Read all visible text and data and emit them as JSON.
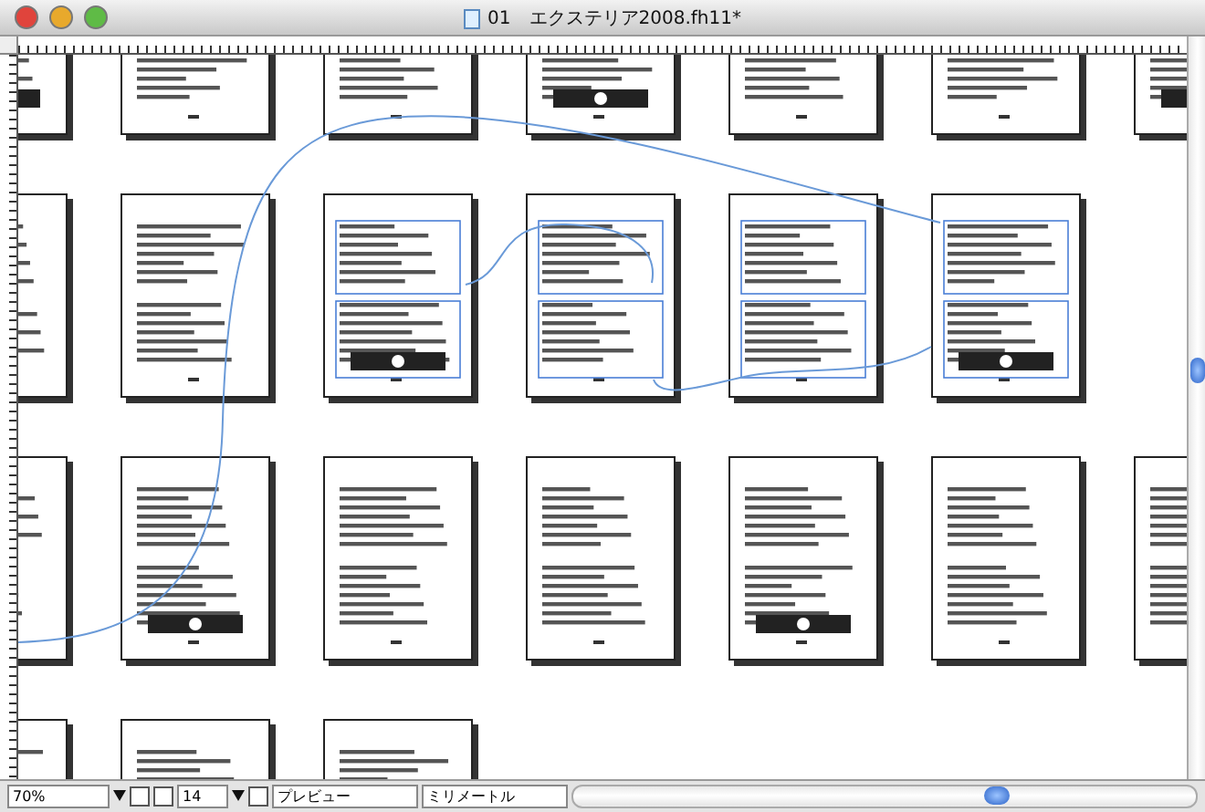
{
  "window": {
    "title": "01　エクステリア2008.fh11*"
  },
  "pasteboard": {
    "page_rows": [
      {
        "pages": [
          {
            "selected": false
          },
          {
            "selected": false
          },
          {
            "selected": false
          },
          {
            "selected": false
          },
          {
            "selected": false
          },
          {
            "selected": false
          },
          {
            "selected": false
          }
        ]
      },
      {
        "pages": [
          {
            "selected": false
          },
          {
            "selected": false
          },
          {
            "selected": true
          },
          {
            "selected": true
          },
          {
            "selected": true
          },
          {
            "selected": true
          }
        ]
      },
      {
        "pages": [
          {
            "selected": false
          },
          {
            "selected": false
          },
          {
            "selected": false
          },
          {
            "selected": false
          },
          {
            "selected": false
          },
          {
            "selected": false
          },
          {
            "selected": false
          }
        ]
      },
      {
        "pages": [
          {
            "selected": false
          },
          {
            "selected": false
          },
          {
            "selected": false
          }
        ]
      }
    ]
  },
  "status_bar": {
    "zoom": "70%",
    "page": "14",
    "display_mode": "プレビュー",
    "units": "ミリメートル"
  }
}
